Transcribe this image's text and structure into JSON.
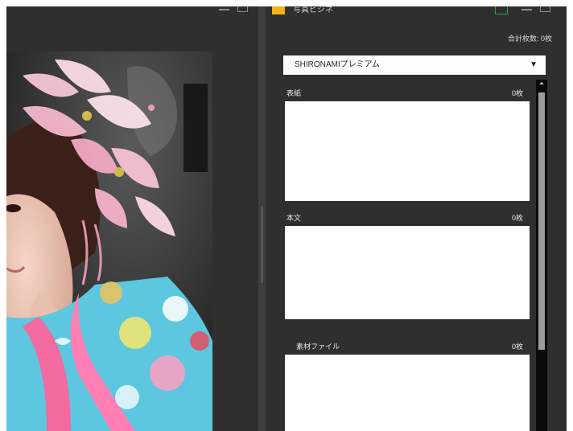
{
  "app_title": "写真ビジネ",
  "total_label": "合計枚数: 0枚",
  "selected_service": "SHIRONAMIプレミアム",
  "sections": [
    {
      "label": "表紙",
      "count": "0枚"
    },
    {
      "label": "本文",
      "count": "0枚"
    },
    {
      "label": "素材ファイル",
      "count": "0枚"
    }
  ],
  "colors": {
    "window_bg": "#2f2f2f",
    "app_icon": "#f0b418",
    "green_accent": "#1fa83a"
  },
  "icons": {
    "minimize": "minimize-icon",
    "maximize": "maximize-icon",
    "dropdown": "chevron-down-icon"
  }
}
